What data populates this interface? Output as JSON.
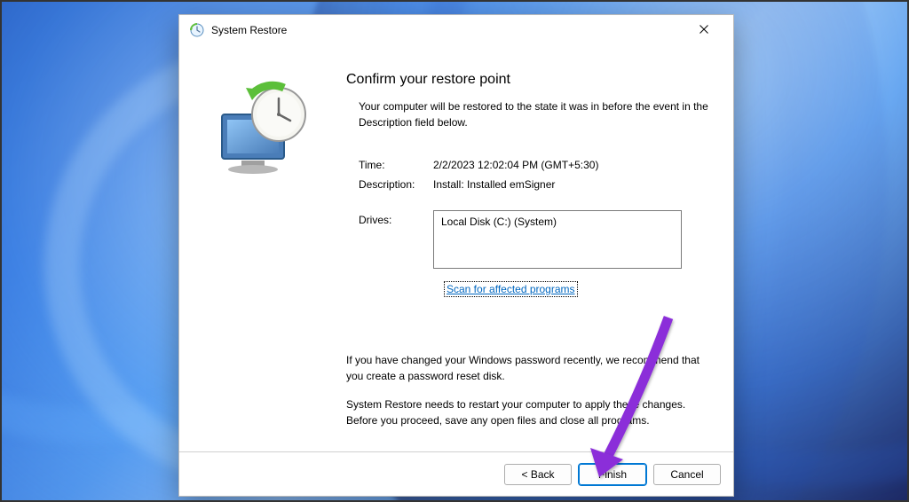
{
  "titlebar": {
    "title": "System Restore"
  },
  "heading": "Confirm your restore point",
  "intro": "Your computer will be restored to the state it was in before the event in the Description field below.",
  "fields": {
    "time_label": "Time:",
    "time_value": "2/2/2023 12:02:04 PM (GMT+5:30)",
    "description_label": "Description:",
    "description_value": "Install: Installed emSigner",
    "drives_label": "Drives:",
    "drives_value": "Local Disk (C:) (System)"
  },
  "scan_link": "Scan for affected programs",
  "notes": {
    "password": "If you have changed your Windows password recently, we recommend that you create a password reset disk.",
    "restart": "System Restore needs to restart your computer to apply these changes. Before you proceed, save any open files and close all programs."
  },
  "buttons": {
    "back": "< Back",
    "finish": "Finish",
    "cancel": "Cancel"
  }
}
